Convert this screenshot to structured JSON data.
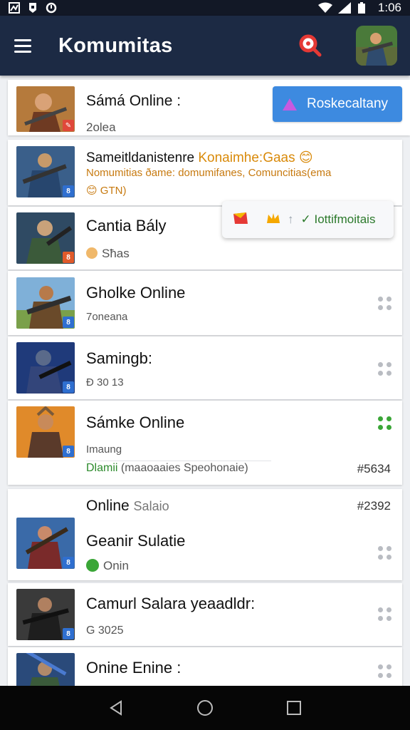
{
  "status_bar": {
    "time": "1:06"
  },
  "app_bar": {
    "title": "Komumitas"
  },
  "featured": {
    "title": "Sámá Online :",
    "subtitle": "2olea",
    "join_label": "Roskecaltany"
  },
  "highlight": {
    "line1_dark": "Sameitldanistenre ",
    "line1_orange": "Konaimhe:Gaas 😊",
    "line2": "Nomumitias ðame: domumifanes, Comuncitias(ema",
    "line3": "😊 GTN)"
  },
  "popup": {
    "label": "✓ Iottifmoitais"
  },
  "items": [
    {
      "title": "Cantia Bály",
      "subtitle": "Sħas"
    },
    {
      "title": "Gholke Online",
      "subtitle": "7oneana"
    },
    {
      "title": "Samingb:",
      "subtitle": "Ð 30 13"
    },
    {
      "title": "Sámke Online",
      "subtitle": "Imaung",
      "tag_green": "Dlamii",
      "tag_rest": " (maaoaaies Speohonaie)",
      "number": "#5634"
    }
  ],
  "section": {
    "title_dark": "Online ",
    "title_gray": "Salaio",
    "number": "#2392"
  },
  "items2": [
    {
      "title": "Geanir Sulatie",
      "subtitle": "Onin"
    },
    {
      "title": "Camurl Salara yeaadldr:",
      "subtitle": "G 3025"
    },
    {
      "title": "Onine Enine :"
    }
  ],
  "colors": {
    "appbar": "#1c2a44",
    "accent_blue": "#3d8ae0",
    "accent_green": "#3aa637",
    "accent_orange": "#d98a0a"
  },
  "icons": [
    "menu-icon",
    "search-icon",
    "wifi-icon",
    "battery-icon",
    "back-icon",
    "home-icon",
    "recents-icon"
  ]
}
